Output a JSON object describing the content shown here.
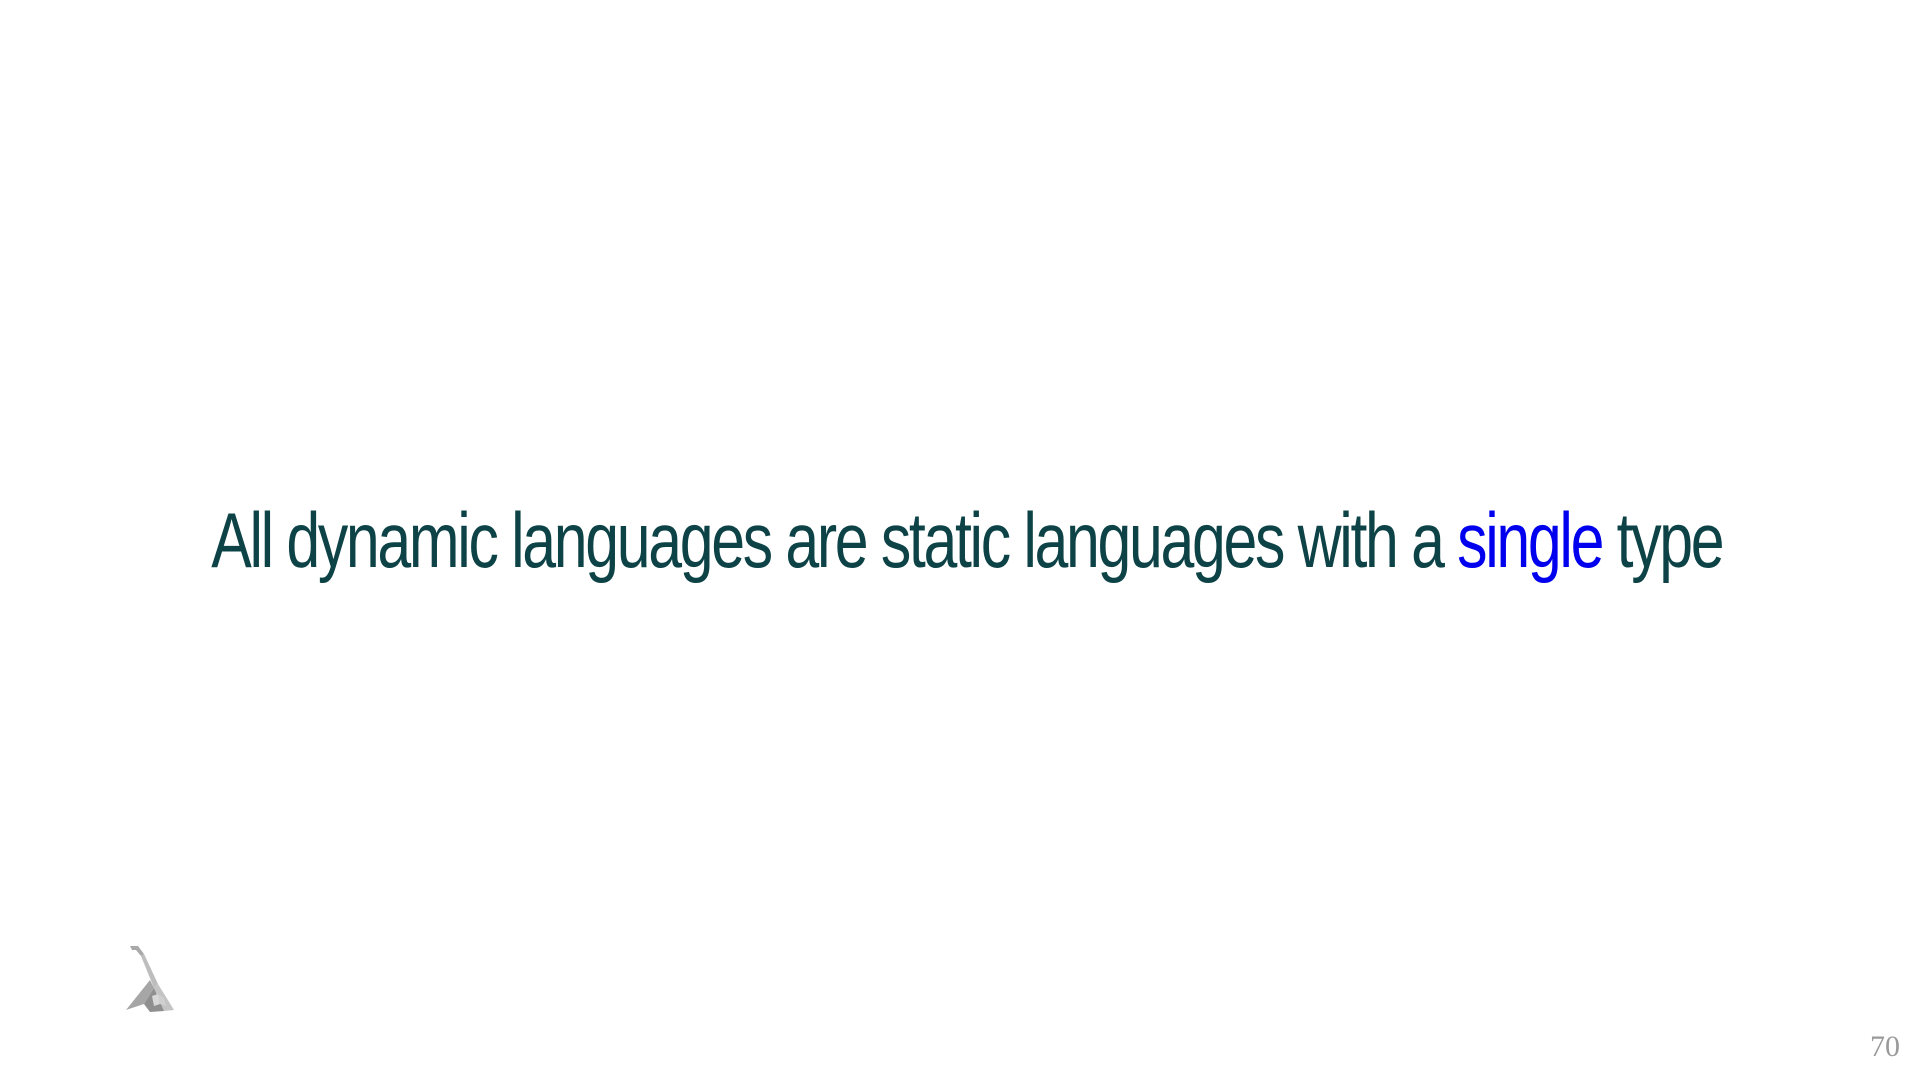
{
  "slide": {
    "headline_before": "All dynamic languages are static languages with a ",
    "headline_highlight": "single",
    "headline_after": " type",
    "page_number": "70"
  },
  "colors": {
    "text": "#0d4347",
    "highlight": "#0000ee",
    "page_number": "#9a9a9a",
    "logo": "#b0b0b0"
  },
  "icons": {
    "logo": "lambda-logo-icon"
  }
}
